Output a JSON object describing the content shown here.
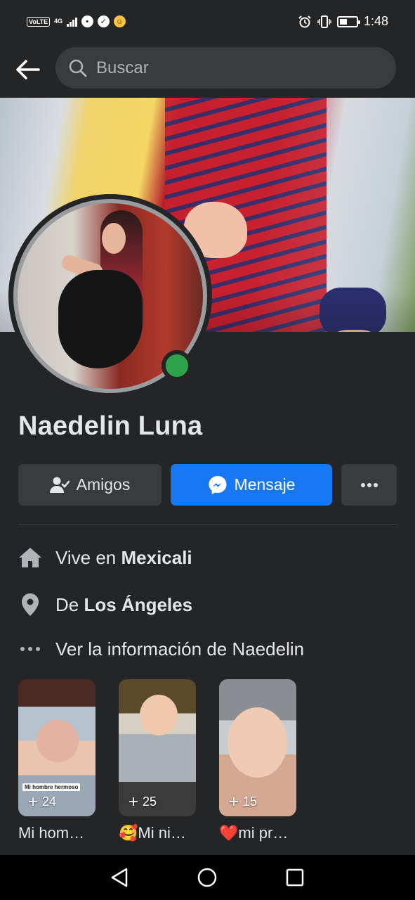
{
  "status_bar": {
    "volte": "VoLTE",
    "network": "4G",
    "time": "1:48"
  },
  "search": {
    "placeholder": "Buscar"
  },
  "profile": {
    "name": "Naedelin Luna",
    "online_color": "#31a24c"
  },
  "actions": {
    "friends_label": "Amigos",
    "message_label": "Mensaje",
    "accent": "#1877f2"
  },
  "info": {
    "lives_prefix": "Vive en ",
    "lives_city": "Mexicali",
    "from_prefix": "De ",
    "from_city": "Los Ángeles",
    "see_more": "Ver la información de Naedelin"
  },
  "highlights": [
    {
      "count": "24",
      "caption": "Mi hom…",
      "sticker": "Mi hombre hermoso"
    },
    {
      "count": "25",
      "caption": "🥰Mi ni…"
    },
    {
      "count": "15",
      "caption": "❤️mi pr…"
    }
  ],
  "icons": {
    "back": "arrow-left-icon",
    "search": "search-icon",
    "friends": "friends-icon",
    "messenger": "messenger-icon",
    "more": "more-dots-icon",
    "home": "home-icon",
    "location": "location-pin-icon"
  }
}
